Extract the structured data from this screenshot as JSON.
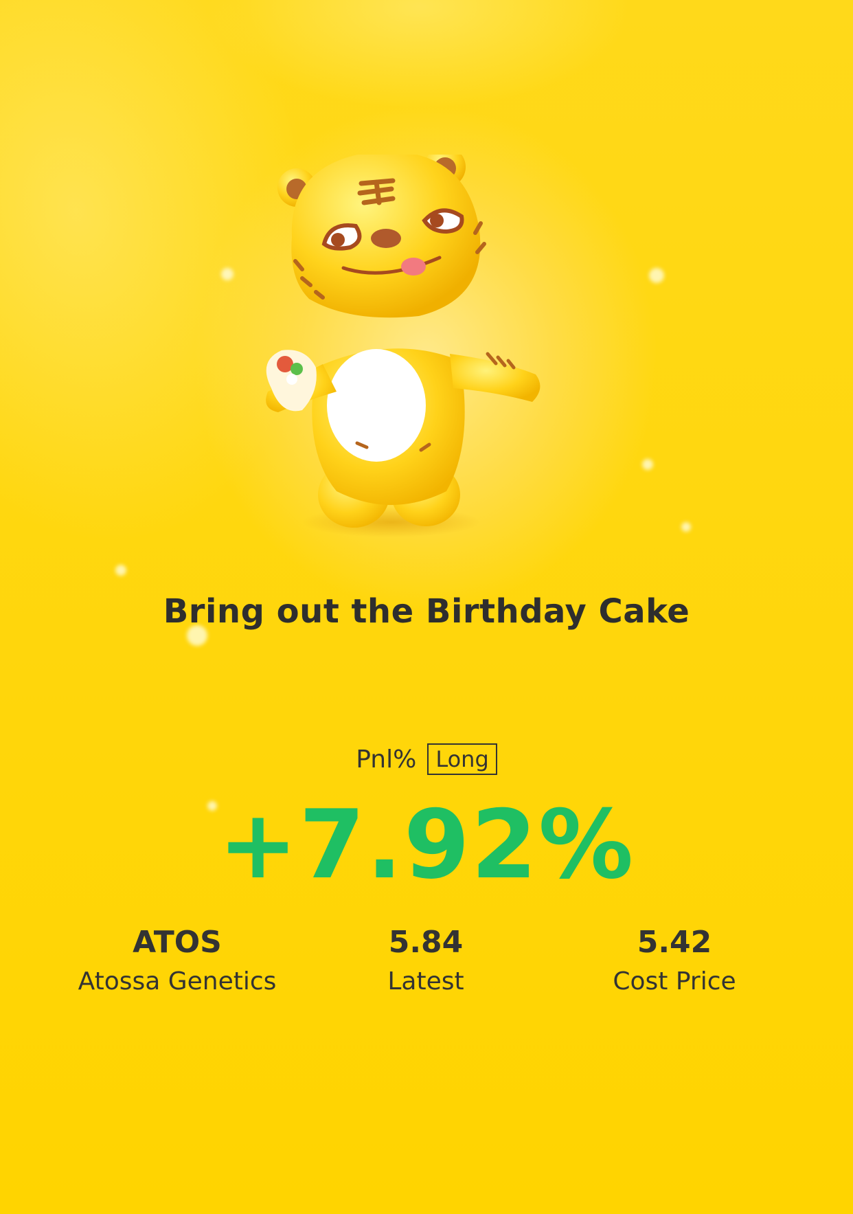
{
  "banner": {
    "title": "Bring out the Birthday Cake"
  },
  "position": {
    "pnl_label": "Pnl%",
    "direction": "Long",
    "pnl_value": "+7.92%",
    "pnl_color": "#1fbf63"
  },
  "stats": [
    {
      "value": "ATOS",
      "label": "Atossa Genetics"
    },
    {
      "value": "5.84",
      "label": "Latest"
    },
    {
      "value": "5.42",
      "label": "Cost Price"
    }
  ],
  "theme": {
    "background": "#ffd60a",
    "text": "#333333"
  },
  "mascot": {
    "icon": "tiger-mascot-icon"
  }
}
